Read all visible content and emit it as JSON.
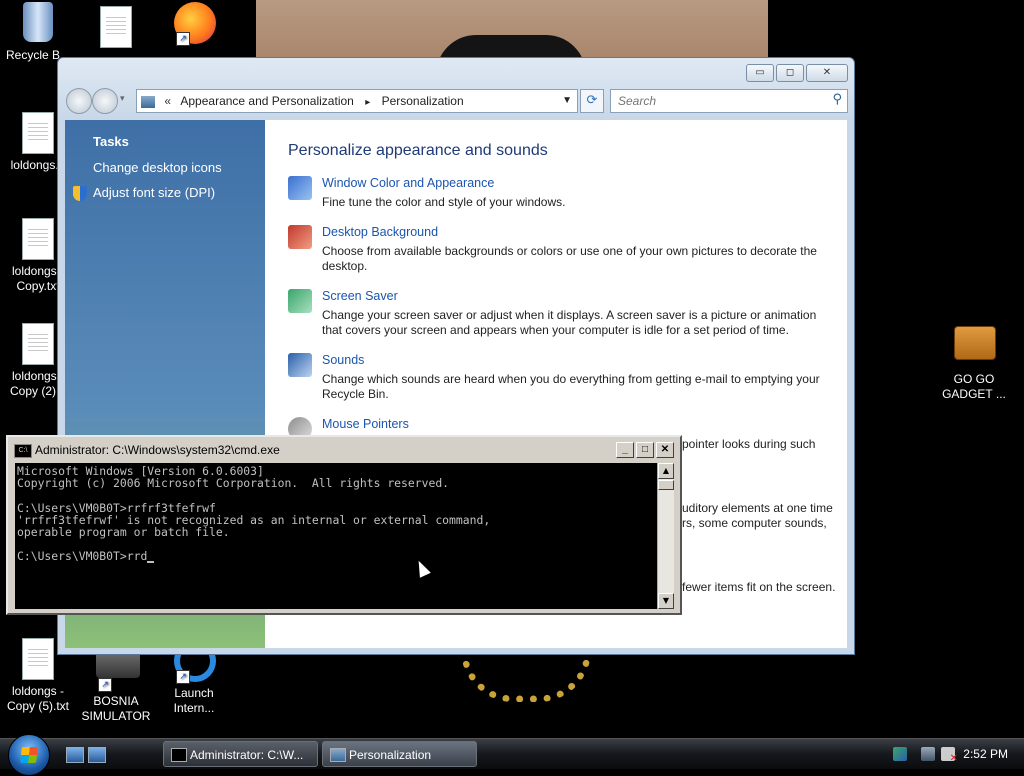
{
  "desktop": {
    "icons": [
      {
        "label": "Recycle B..."
      },
      {
        "label": ""
      },
      {
        "label": ""
      },
      {
        "label": "loldongs..."
      },
      {
        "label": "loldongs - Copy.txt"
      },
      {
        "label": "loldongs - Copy (2)..."
      },
      {
        "label": "loldongs - Copy (5).txt"
      },
      {
        "label": "BOSNIA SIMULATOR"
      },
      {
        "label": "Launch Intern..."
      },
      {
        "label": "GO GO GADGET ..."
      }
    ]
  },
  "personalization_window": {
    "breadcrumb_chevron": "«",
    "breadcrumb": [
      "Appearance and Personalization",
      "Personalization"
    ],
    "search_placeholder": "Search",
    "controls": {
      "minimize": "▭",
      "maximize": "◻",
      "close": "✕"
    },
    "tasks": {
      "heading": "Tasks",
      "links": [
        "Change desktop icons",
        "Adjust font size (DPI)"
      ]
    },
    "content_title": "Personalize appearance and sounds",
    "items": [
      {
        "title": "Window Color and Appearance",
        "description": "Fine tune the color and style of your windows.",
        "icon": "window-color-icon",
        "color": "#3a6fd0"
      },
      {
        "title": "Desktop Background",
        "description": "Choose from available backgrounds or colors or use one of your own pictures to decorate the desktop.",
        "icon": "desktop-background-icon",
        "color": "#c0392b"
      },
      {
        "title": "Screen Saver",
        "description": "Change your screen saver or adjust when it displays. A screen saver is a picture or animation that covers your screen and appears when your computer is idle for a set period of time.",
        "icon": "screen-saver-icon",
        "color": "#3aa56a"
      },
      {
        "title": "Sounds",
        "description": "Change which sounds are heard when you do everything from getting e-mail to emptying your Recycle Bin.",
        "icon": "sounds-icon",
        "color": "#2a5fa8"
      },
      {
        "title": "Mouse Pointers",
        "description": "",
        "icon": "mouse-pointers-icon",
        "color": "#8c8c8c"
      }
    ],
    "partially_hidden_text": [
      "pointer looks during such",
      "uditory elements at one time",
      "rs, some computer sounds,",
      "fewer items fit on the screen."
    ]
  },
  "cmd_window": {
    "title": "Administrator: C:\\Windows\\system32\\cmd.exe",
    "icon_text": "C:\\",
    "controls": {
      "minimize": "_",
      "maximize": "□",
      "close": "✕"
    },
    "lines": [
      "Microsoft Windows [Version 6.0.6003]",
      "Copyright (c) 2006 Microsoft Corporation.  All rights reserved.",
      "",
      "C:\\Users\\VM0B0T>rrfrf3tfefrwf",
      "'rrfrf3tfefrwf' is not recognized as an internal or external command,",
      "operable program or batch file.",
      "",
      "C:\\Users\\VM0B0T>rrd"
    ]
  },
  "taskbar": {
    "buttons": [
      {
        "label": "Administrator: C:\\W...",
        "icon": "cmd-icon"
      },
      {
        "label": "Personalization",
        "icon": "control-panel-icon"
      }
    ],
    "clock": "2:52 PM"
  }
}
